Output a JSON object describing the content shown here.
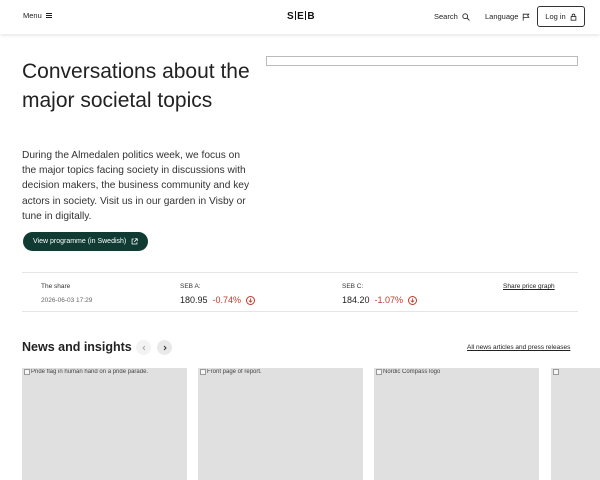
{
  "header": {
    "menu_label": "Menu",
    "logo_text": "SEB",
    "search_label": "Search",
    "language_label": "Language",
    "login_label": "Log in"
  },
  "hero": {
    "title": "Conversations about the major societal topics",
    "text": "During the Almedalen politics week, we focus on the major topics facing society in discussions with decision makers, the business community and key actors in society. Visit us in our garden in Visby or tune in digitally.",
    "cta_label": "View programme (in Swedish)",
    "cta_color": "#0f3b33"
  },
  "share": {
    "label": "The share",
    "timestamp": "2026-06-03 17:29",
    "stocks": [
      {
        "name": "SEB A:",
        "price": "180.95",
        "change": "-0.74%",
        "trend": "down"
      },
      {
        "name": "SEB C:",
        "price": "184.20",
        "change": "-1.07%",
        "trend": "down"
      }
    ],
    "graph_link": "Share price graph",
    "negative_color": "#c0392b"
  },
  "news": {
    "title": "News and insights",
    "all_link": "All news articles and press releases",
    "cards": [
      {
        "alt": "Pride flag in human hand on a pride parade."
      },
      {
        "alt": "Front page of report."
      },
      {
        "alt": "Nordic Compass logo"
      },
      {
        "alt": ""
      }
    ]
  }
}
